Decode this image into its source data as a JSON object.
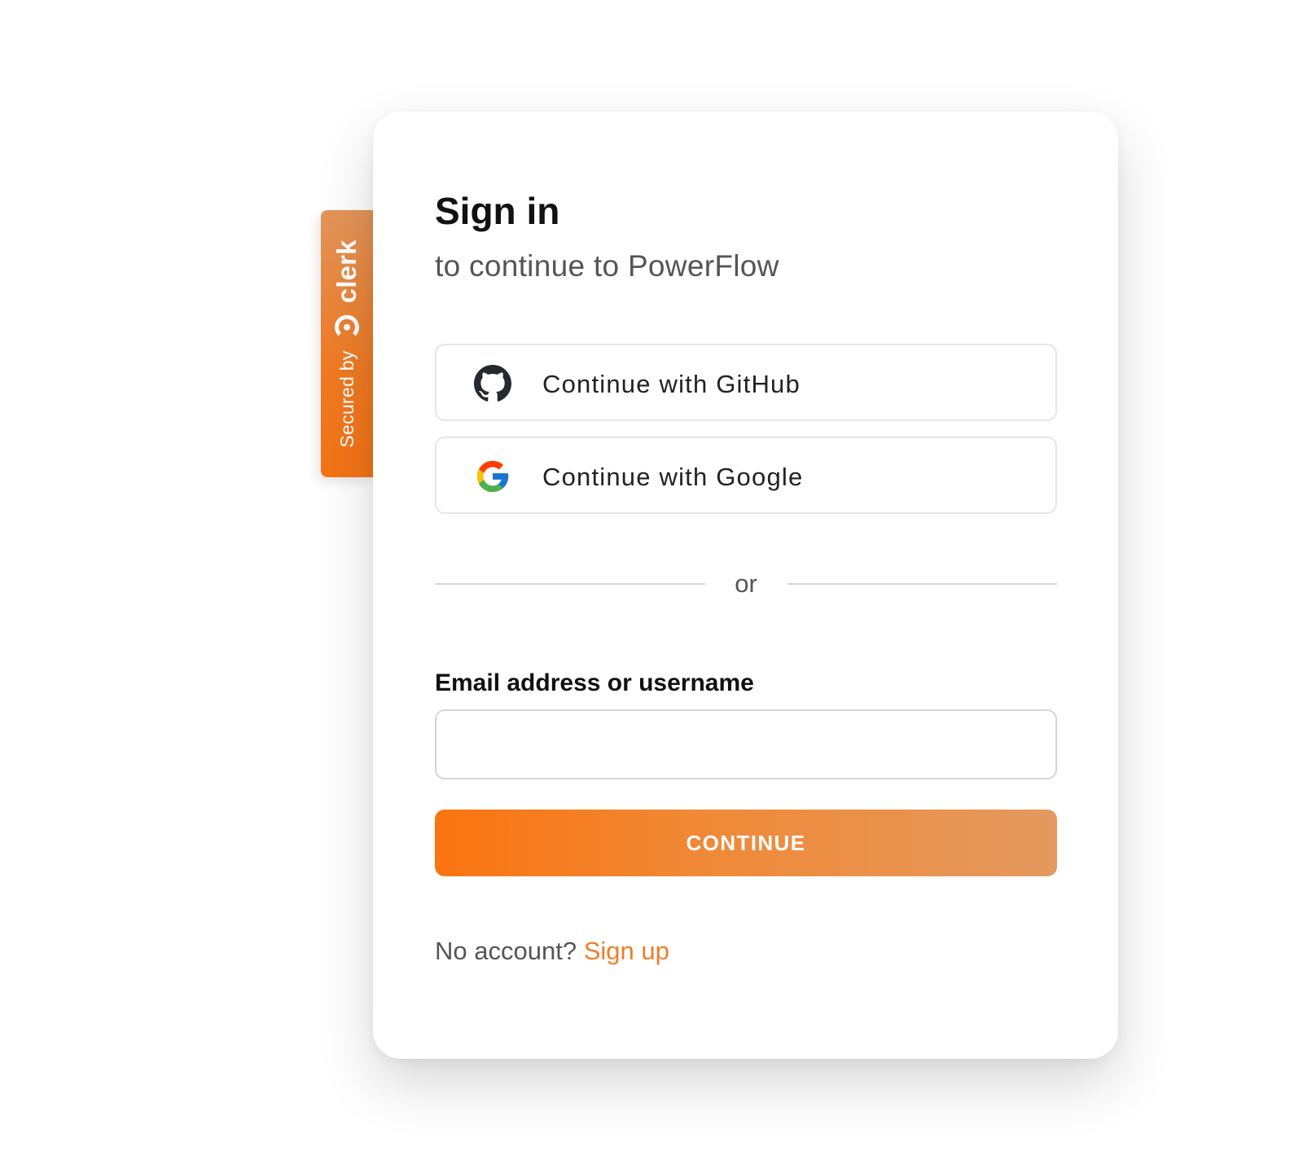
{
  "badge": {
    "secured_text": "Secured by",
    "brand_text": "clerk",
    "logo_icon": "clerk-logo-icon",
    "color": "#f07a22"
  },
  "card": {
    "title": "Sign in",
    "subtitle": "to continue to PowerFlow"
  },
  "social": {
    "github": {
      "label": "Continue with GitHub",
      "icon": "github-icon"
    },
    "google": {
      "label": "Continue with Google",
      "icon": "google-icon"
    }
  },
  "divider": {
    "text": "or"
  },
  "form": {
    "email_label": "Email address or username",
    "email_value": "",
    "continue_label": "CONTINUE",
    "continue_color": "#fa7410"
  },
  "footer": {
    "prompt": "No account?",
    "signup_label": "Sign up",
    "link_color": "#ef7d28"
  }
}
